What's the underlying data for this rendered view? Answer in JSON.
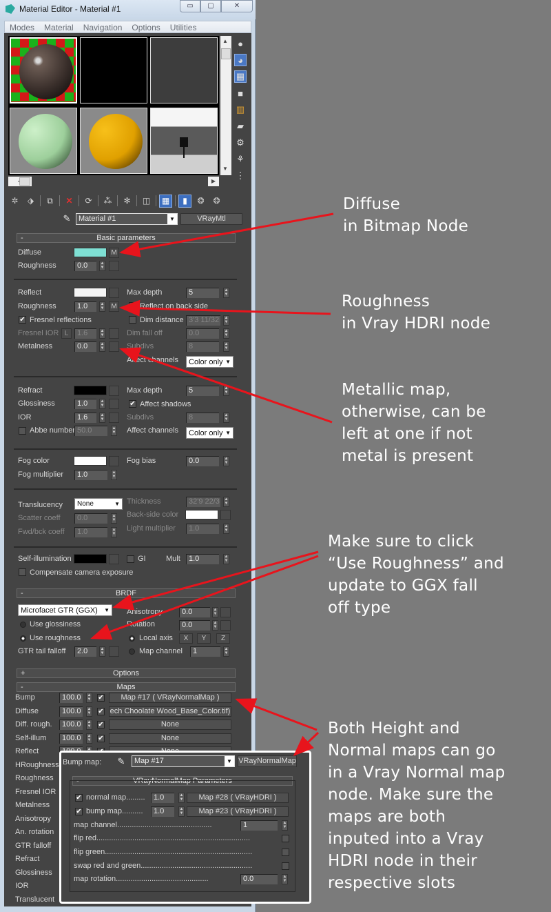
{
  "window": {
    "title": "Material Editor - Material #1",
    "minimize_icon": "minimize-icon",
    "maximize_icon": "maximize-icon",
    "close_icon": "close-icon"
  },
  "menu": [
    "Modes",
    "Material",
    "Navigation",
    "Options",
    "Utilities"
  ],
  "material_selector": {
    "name": "Material #1",
    "type": "VRayMtl"
  },
  "basic_parameters": {
    "header": "Basic parameters",
    "collapse": "-",
    "diffuse_label": "Diffuse",
    "diffuse_color": "#7fe0d4",
    "diffuse_map_btn": "M",
    "roughness_label": "Roughness",
    "roughness_value": "0.0",
    "reflect": {
      "reflect_label": "Reflect",
      "reflect_color": "#f5f5f5",
      "roughness_label": "Roughness",
      "roughness_value": "1.0",
      "roughness_map_btn": "M",
      "fresnel_label": "Fresnel reflections",
      "fresnel_checked": true,
      "fresnel_ior_label": "Fresnel IOR",
      "fresnel_ior_lock": "L",
      "fresnel_ior_value": "1.6",
      "metalness_label": "Metalness",
      "metalness_value": "0.0",
      "max_depth_label": "Max depth",
      "max_depth_value": "5",
      "reflect_back_label": "Reflect on back side",
      "dim_distance_label": "Dim distance",
      "dim_distance_value": "3'3 11/32",
      "dim_falloff_label": "Dim fall off",
      "dim_falloff_value": "0.0",
      "subdivs_label": "Subdivs",
      "subdivs_value": "8",
      "affect_channels_label": "Affect channels",
      "affect_channels_value": "Color only"
    },
    "refract": {
      "refract_label": "Refract",
      "refract_color": "#000000",
      "glossiness_label": "Glossiness",
      "glossiness_value": "1.0",
      "ior_label": "IOR",
      "ior_value": "1.6",
      "abbe_label": "Abbe number",
      "abbe_value": "50.0",
      "max_depth_label": "Max depth",
      "max_depth_value": "5",
      "affect_shadows_label": "Affect shadows",
      "subdivs_label": "Subdivs",
      "subdivs_value": "8",
      "affect_channels_label": "Affect channels",
      "affect_channels_value": "Color only"
    },
    "fog": {
      "fog_color_label": "Fog color",
      "fog_color": "#ffffff",
      "fog_multiplier_label": "Fog multiplier",
      "fog_multiplier_value": "1.0",
      "fog_bias_label": "Fog bias",
      "fog_bias_value": "0.0"
    },
    "translucency": {
      "translucency_label": "Translucency",
      "translucency_value": "None",
      "scatter_label": "Scatter coeff",
      "scatter_value": "0.0",
      "fwdbck_label": "Fwd/bck coeff",
      "fwdbck_value": "1.0",
      "thickness_label": "Thickness",
      "thickness_value": "32'9 22/3",
      "backside_label": "Back-side color",
      "backside_color": "#ffffff",
      "light_mult_label": "Light multiplier",
      "light_mult_value": "1.0"
    },
    "self_illum": {
      "label": "Self-illumination",
      "color": "#000000",
      "gi_label": "GI",
      "mult_label": "Mult",
      "mult_value": "1.0",
      "compensate_label": "Compensate camera exposure"
    }
  },
  "brdf": {
    "header": "BRDF",
    "collapse": "-",
    "type_value": "Microfacet GTR (GGX)",
    "use_glossiness_label": "Use glossiness",
    "use_roughness_label": "Use roughness",
    "gtr_label": "GTR tail falloff",
    "gtr_value": "2.0",
    "anisotropy_label": "Anisotropy",
    "anisotropy_value": "0.0",
    "rotation_label": "Rotation",
    "rotation_value": "0.0",
    "local_axis_label": "Local axis",
    "axis_x": "X",
    "axis_y": "Y",
    "axis_z": "Z",
    "map_channel_label": "Map channel",
    "map_channel_value": "1"
  },
  "options": {
    "header": "Options",
    "expand": "+"
  },
  "maps": {
    "header": "Maps",
    "collapse": "-",
    "rows": [
      {
        "label": "Bump",
        "amount": "100.0",
        "map": "Map #17  ( VRayNormalMap )"
      },
      {
        "label": "Diffuse",
        "amount": "100.0",
        "map": "ech Choolate Wood_Base_Color.tif)"
      },
      {
        "label": "Diff. rough.",
        "amount": "100.0",
        "map": "None"
      },
      {
        "label": "Self-illum",
        "amount": "100.0",
        "map": "None"
      },
      {
        "label": "Reflect",
        "amount": "100.0",
        "map": "None"
      },
      {
        "label": "HRoughness"
      },
      {
        "label": "Roughness"
      },
      {
        "label": "Fresnel IOR"
      },
      {
        "label": "Metalness"
      },
      {
        "label": "Anisotropy"
      },
      {
        "label": "An. rotation"
      },
      {
        "label": "GTR falloff"
      },
      {
        "label": "Refract"
      },
      {
        "label": "Glossiness"
      },
      {
        "label": "IOR"
      },
      {
        "label": "Translucent"
      }
    ]
  },
  "bump_popup": {
    "label": "Bump map:",
    "map_name": "Map #17",
    "map_type": "VRayNormalMap",
    "params_header": "VRayNormalMap Parameters",
    "collapse": "-",
    "normal_label": "normal map.........",
    "normal_value": "1.0",
    "normal_map": "Map #28  ( VRayHDRI )",
    "bump_label": "bump map..........",
    "bump_value": "1.0",
    "bump_map": "Map #23  ( VRayHDRI )",
    "map_channel_label": "map channel.............................................",
    "map_channel_value": "1",
    "flip_red_label": "flip red.........................................................................",
    "flip_green_label": "flip green......................................................................",
    "swap_label": "swap red and green.....................................................",
    "rotation_label": "map rotation............................................",
    "rotation_value": "0.0"
  },
  "annotations": {
    "accent_color": "#e8141c",
    "diffuse": [
      "Diffuse",
      "in Bitmap Node"
    ],
    "roughness": [
      "Roughness",
      "in Vray HDRI node"
    ],
    "metallic": [
      "Metallic map,",
      "otherwise, can be",
      "left at one if not",
      "metal is present"
    ],
    "brdf": [
      "Make sure to click",
      "“Use Roughness” and",
      "update to GGX fall",
      "off type"
    ],
    "normal": [
      "Both Height and",
      "Normal maps can go",
      "in a Vray Normal map",
      "node. Make sure the",
      "maps are both",
      "inputed into a Vray",
      "HDRI node in their",
      "respective slots"
    ]
  }
}
